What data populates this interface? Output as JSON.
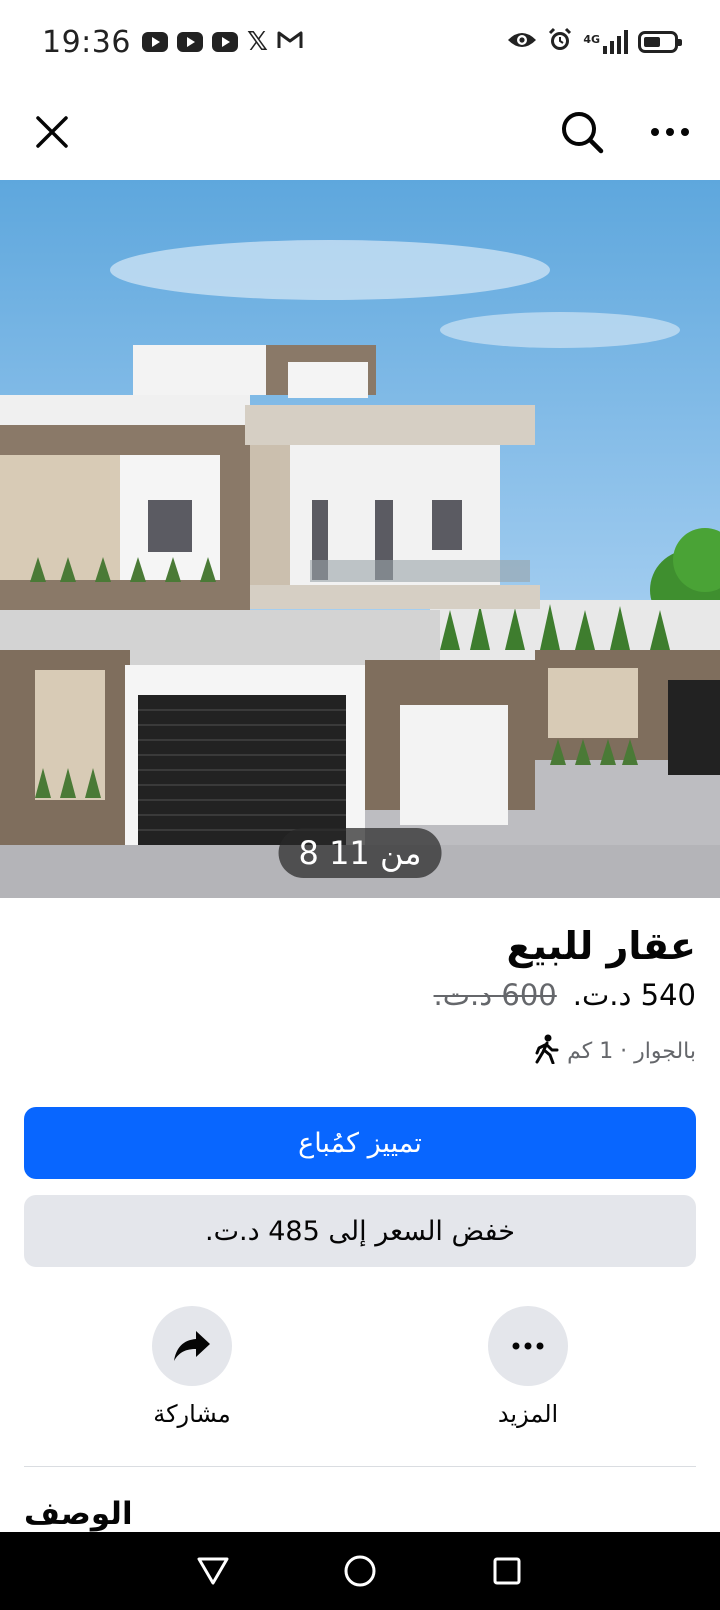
{
  "status_bar": {
    "time": "19:36",
    "network_label": "4G",
    "left_icons": [
      "youtube-icon",
      "youtube-icon",
      "youtube-icon",
      "x-icon",
      "gmail-icon"
    ],
    "right_icons": [
      "eye-icon",
      "alarm-icon",
      "signal-icon",
      "battery-icon"
    ]
  },
  "top_nav": {
    "close_icon": "close-icon",
    "search_icon": "search-icon",
    "more_icon": "more-horizontal-icon"
  },
  "gallery": {
    "counter": "8 من 11"
  },
  "listing": {
    "title": "عقار للبيع",
    "price_current": "540 د.ت.",
    "price_old": "600 د.ت.",
    "location": "بالجوار · 1 كم"
  },
  "buttons": {
    "boost": "تمييز كمُباع",
    "reduce_price": "خفض السعر إلى 485 د.ت."
  },
  "actions": {
    "share_label": "مشاركة",
    "more_label": "المزيد"
  },
  "sections": {
    "description_title": "الوصف"
  },
  "colors": {
    "primary": "#0866ff",
    "secondary_bg": "#e4e6eb",
    "muted_text": "#65676b"
  }
}
